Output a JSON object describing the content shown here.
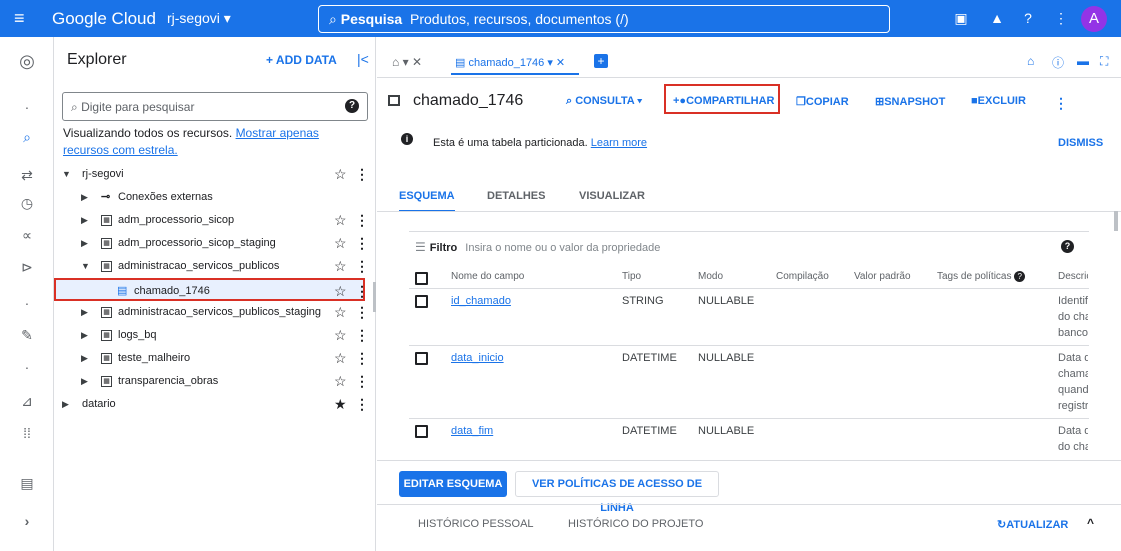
{
  "topbar": {
    "menu_icon": "menu-icon",
    "logo": "Google Cloud",
    "project": "rj-segovi ▾",
    "search_bold": "Pesquisa",
    "search_rest": "Produtos, recursos, documentos (/)",
    "avatar": "A"
  },
  "explorer": {
    "title": "Explorer",
    "add_data": "+ ADD DATA",
    "search_placeholder": "Digite para pesquisar",
    "viewing_text": "Visualizando todos os recursos.",
    "viewing_link": "Mostrar apenas recursos com estrela.",
    "tree": [
      {
        "label": "rj-segovi",
        "starred": "☆"
      },
      {
        "label": "Conexões externas"
      },
      {
        "label": "adm_processorio_sicop",
        "starred": "☆"
      },
      {
        "label": "adm_processorio_sicop_staging",
        "starred": "☆"
      },
      {
        "label": "administracao_servicos_publicos",
        "starred": "☆"
      },
      {
        "label": "chamado_1746",
        "starred": "☆"
      },
      {
        "label": "administracao_servicos_publicos_staging",
        "starred": "☆"
      },
      {
        "label": "logs_bq",
        "starred": "☆"
      },
      {
        "label": "teste_malheiro",
        "starred": "☆"
      },
      {
        "label": "transparencia_obras",
        "starred": "☆"
      },
      {
        "label": "datario",
        "starred": "★"
      }
    ]
  },
  "tabs": {
    "active_tab": "chamado_1746 ▾ ✕"
  },
  "table_header": {
    "name": "chamado_1746",
    "consulta": "CONSULTA ▾",
    "compartilhar": "COMPARTILHAR",
    "copiar": "COPIAR",
    "snapshot": "SNAPSHOT",
    "excluir": "EXCLUIR"
  },
  "info": {
    "text": "Esta é uma tabela particionada.",
    "link": "Learn more",
    "dismiss": "DISMISS"
  },
  "subtabs": {
    "esquema": "ESQUEMA",
    "detalhes": "DETALHES",
    "visualizar": "VISUALIZAR"
  },
  "filter": {
    "label": "Filtro",
    "placeholder": "Insira o nome ou o valor da propriedade"
  },
  "columns": [
    "Nome do campo",
    "Tipo",
    "Modo",
    "Compilação",
    "Valor padrão",
    "Tags de políticas",
    "Descriç"
  ],
  "rows": [
    {
      "name": "id_chamado",
      "type": "STRING",
      "mode": "NULLABLE",
      "desc": [
        "Identifi",
        "do cha",
        "banco"
      ]
    },
    {
      "name": "data_inicio",
      "type": "DATETIME",
      "mode": "NULLABLE",
      "desc": [
        "Data de",
        "chama",
        "quando",
        "registr"
      ]
    },
    {
      "name": "data_fim",
      "type": "DATETIME",
      "mode": "NULLABLE",
      "desc": [
        "Data de",
        "do cha"
      ]
    }
  ],
  "buttons": {
    "edit_schema": "EDITAR ESQUEMA",
    "row_policies": "VER POLÍTICAS DE ACESSO DE LINHA"
  },
  "bottom": {
    "personal": "HISTÓRICO PESSOAL",
    "project": "HISTÓRICO DO PROJETO",
    "refresh": "ATUALIZAR"
  }
}
